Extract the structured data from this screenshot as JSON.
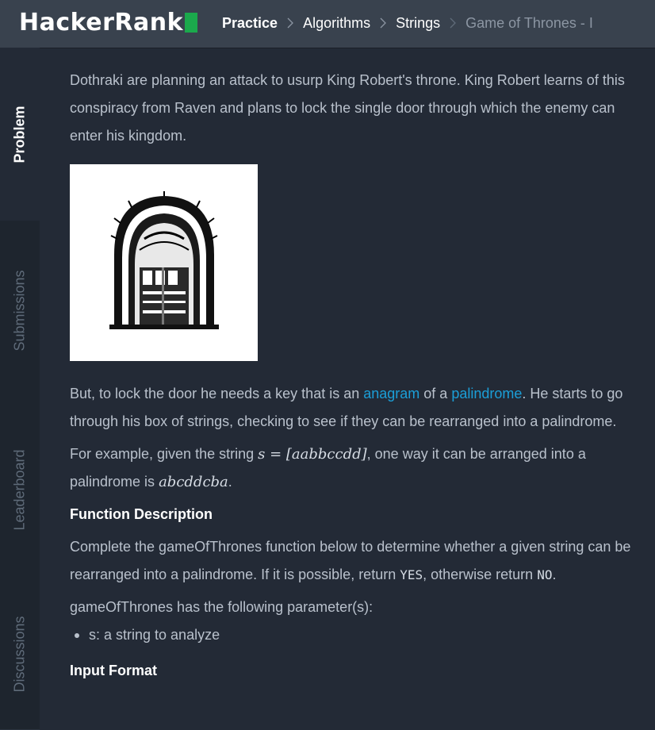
{
  "header": {
    "logo_text": "HackerRank",
    "breadcrumbs": [
      "Practice",
      "Algorithms",
      "Strings",
      "Game of Thrones - I"
    ]
  },
  "sidebar": {
    "tabs": [
      "Problem",
      "Submissions",
      "Leaderboard",
      "Discussions"
    ],
    "active": "Problem"
  },
  "problem": {
    "intro": "Dothraki are planning an attack to usurp King Robert's throne. King Robert learns of this conspiracy from Raven and plans to lock the single door through which the enemy can enter his kingdom.",
    "image_alt": "door",
    "p2_before": "But, to lock the door he needs a key that is an ",
    "link_anagram": "anagram",
    "p2_middle": " of a ",
    "link_palindrome": "palindrome",
    "p2_after": ". He starts to go through his box of strings, checking to see if they can be rearranged into a palindrome.",
    "example_before": "For example, given the string ",
    "example_math1": "s = [aabbccdd]",
    "example_middle": ", one way it can be arranged into a palindrome is ",
    "example_math2": "abcddcba",
    "example_end": ".",
    "func_heading": "Function Description",
    "func_text_before": "Complete the gameOfThrones function below to determine whether a given string can be rearranged into a palindrome. If it is possible, return ",
    "func_yes": "YES",
    "func_text_middle": ", otherwise return ",
    "func_no": "NO",
    "func_text_end": ".",
    "params_intro": "gameOfThrones has the following parameter(s):",
    "params": [
      "s: a string to analyze"
    ],
    "input_heading": "Input Format"
  },
  "colors": {
    "topbar": "#39424e",
    "background": "#232a36",
    "link": "#1b9fd8",
    "logo_accent": "#1ba94c"
  }
}
